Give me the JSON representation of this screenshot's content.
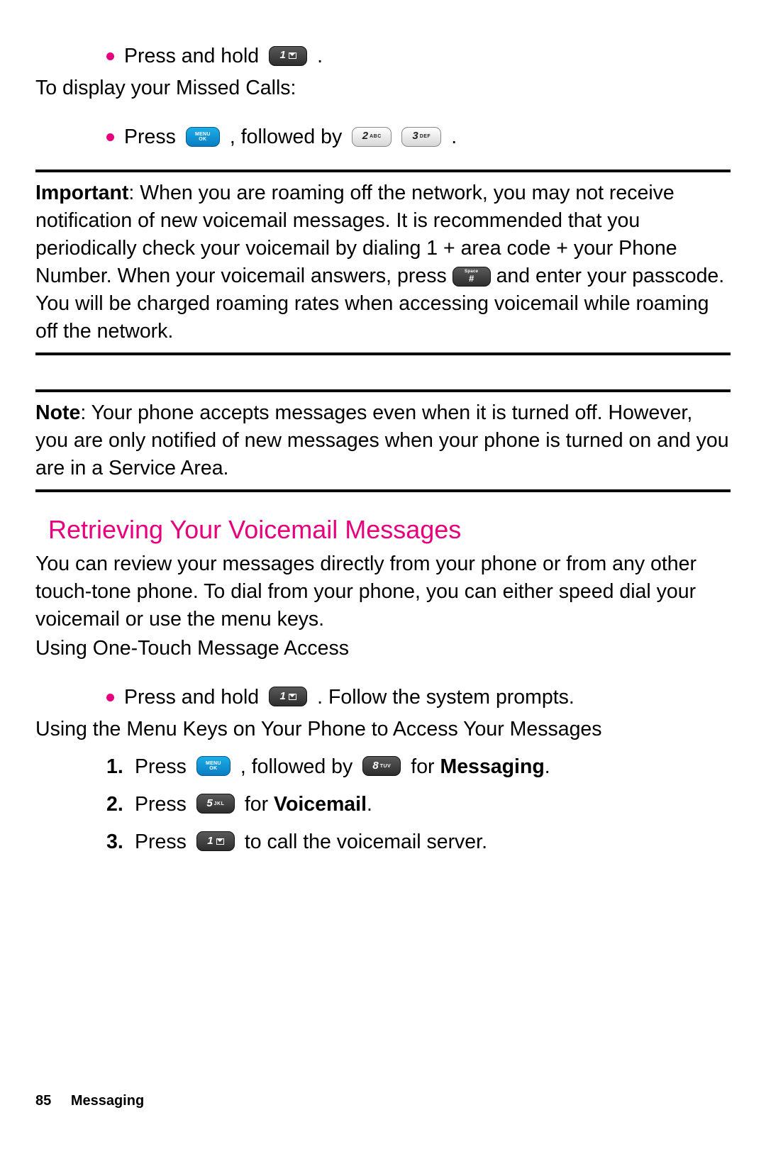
{
  "icons": {
    "one_key": {
      "num": "1"
    },
    "menu_key": {
      "top": "MENU",
      "bottom": "OK"
    },
    "two_key": {
      "num": "2",
      "sub": "ABC"
    },
    "three_key": {
      "num": "3",
      "sub": "DEF"
    },
    "hash_key": {
      "top": "Space",
      "main": "#"
    },
    "eight_key": {
      "num": "8",
      "sub": "TUV"
    },
    "five_key": {
      "num": "5",
      "sub": "JKL"
    }
  },
  "intro": {
    "bullet1_pre": "Press and hold",
    "bullet1_post": ".",
    "missed_calls": "To display your Missed Calls:",
    "bullet2_pre": "Press",
    "bullet2_mid": ", followed by",
    "bullet2_post": "."
  },
  "important": {
    "label": "Important",
    "text_pre": ": When you are roaming off the network, you may not receive notification of new voicemail messages. It is recommended that you periodically check your voicemail by dialing 1 + area code + your Phone Number. When your voicemail answers, press ",
    "text_post": " and enter your passcode. You will be charged roaming rates when accessing voicemail while roaming off the network."
  },
  "note": {
    "label": "Note",
    "text": ": Your phone accepts messages even when it is turned off. However, you are only notified of new messages when your phone is turned on and you are in a Service Area."
  },
  "section": {
    "heading": "Retrieving Your Voicemail Messages",
    "para": "You can review your messages directly from your phone or from any other touch-tone phone. To dial from your phone, you can either speed dial your voicemail or use the menu keys.",
    "onetouch": "Using One-Touch Message Access",
    "bullet_pre": "Press and hold",
    "bullet_post": ". Follow the system prompts.",
    "menukeys": "Using the Menu Keys on Your Phone to Access Your Messages",
    "steps": [
      {
        "n": "1.",
        "pre": "Press",
        "mid": ", followed by",
        "for": " for ",
        "bold": "Messaging",
        "end": "."
      },
      {
        "n": "2.",
        "pre": "Press",
        "for": " for ",
        "bold": "Voicemail",
        "end": "."
      },
      {
        "n": "3.",
        "pre": "Press",
        "post": " to call the voicemail server."
      }
    ]
  },
  "footer": {
    "page": "85",
    "section": "Messaging"
  }
}
